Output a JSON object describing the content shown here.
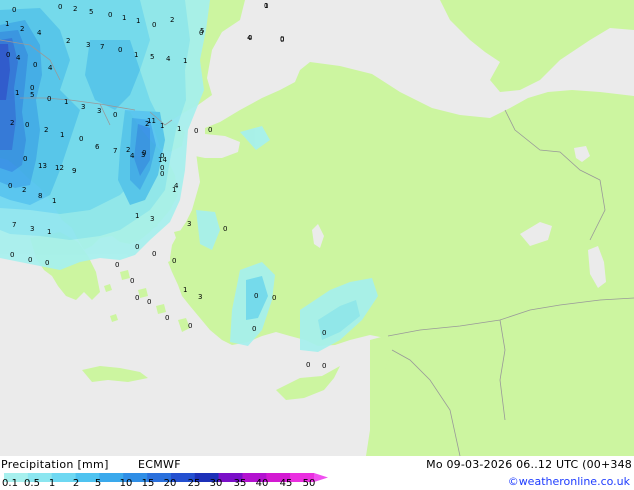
{
  "title": "Precipitation [mm]",
  "model": "ECMWF",
  "timestamp": "Mo 09-03-2026 06..12 UTC (00+348",
  "credit": "©weatheronline.co.uk",
  "legend": {
    "ticks": [
      "0.1",
      "0.5",
      "1",
      "2",
      "5",
      "10",
      "15",
      "20",
      "25",
      "30",
      "35",
      "40",
      "45",
      "50"
    ],
    "colors": [
      "#a6f0ee",
      "#8ce6f0",
      "#6ed8f2",
      "#4fc3f0",
      "#3aa9ec",
      "#2f8ee6",
      "#2a70dc",
      "#2450d0",
      "#1c30b8",
      "#7a0fc8",
      "#b312d0",
      "#d31ad2",
      "#ea2fe0"
    ]
  },
  "colors": {
    "sea": "#ebebeb",
    "land": "#ccf5a0",
    "border": "#999999"
  },
  "precip_values": [
    "0",
    "2",
    "5",
    "0",
    "1",
    "1",
    "0",
    "2",
    "5",
    "1",
    "1",
    "2",
    "4",
    "0",
    "4",
    "0",
    "4",
    "2",
    "3",
    "7",
    "0",
    "1",
    "5",
    "4",
    "1",
    "0",
    "4",
    "0",
    "1",
    "5",
    "0",
    "1",
    "3",
    "3",
    "0",
    "2",
    "0",
    "2",
    "1",
    "0",
    "6",
    "7",
    "4",
    "2",
    "1",
    "1",
    "0",
    "0",
    "11",
    "2",
    "0",
    "0",
    "0",
    "13",
    "12",
    "9",
    "3",
    "14",
    "4",
    "0",
    "2",
    "8",
    "1",
    "0",
    "1",
    "7",
    "3",
    "1",
    "1",
    "3",
    "3",
    "0",
    "0",
    "0",
    "0",
    "0",
    "0",
    "1",
    "3",
    "0",
    "0",
    "0",
    "0",
    "0",
    "0",
    "0",
    "0",
    "0",
    "0",
    "0",
    "0",
    "0",
    "0",
    "0",
    "0",
    "0",
    "0",
    "0"
  ]
}
